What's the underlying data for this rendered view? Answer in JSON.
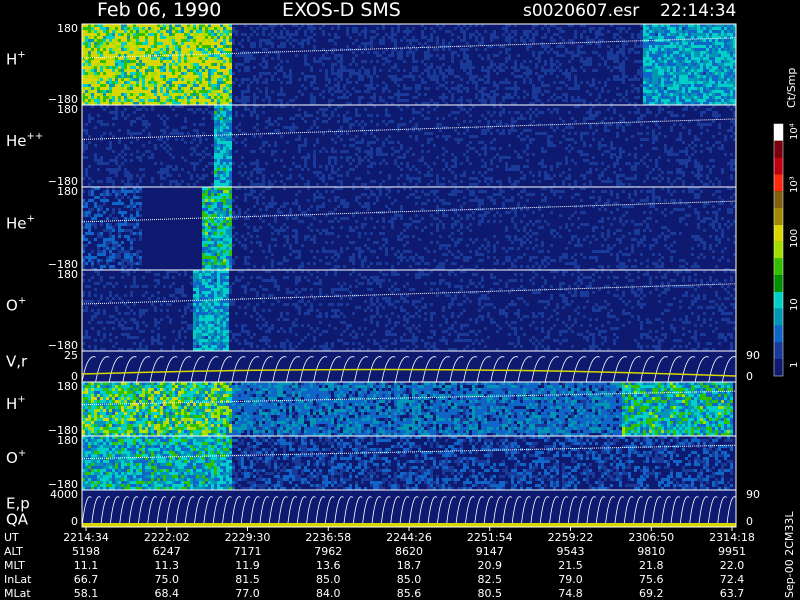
{
  "header": {
    "date": "Feb 06, 1990",
    "mission": "EXOS-D SMS",
    "file": "s0020607.esr",
    "time": "22:14:34"
  },
  "colorbar": {
    "title": "Ct/Smp",
    "ticks": [
      "10⁴",
      "10³",
      "100",
      "10",
      "1"
    ],
    "colors": [
      "#ffffff",
      "#7a0010",
      "#c00010",
      "#ff2a10",
      "#806010",
      "#a08a00",
      "#d8d800",
      "#a0e000",
      "#30c000",
      "#009000",
      "#00d0c8",
      "#0096b4",
      "#1066c8",
      "#1a3a9a",
      "#0d1a70"
    ]
  },
  "panels": [
    {
      "id": "h-plus",
      "label": "H",
      "sup": "+",
      "ytop": "180",
      "ybot": "−180"
    },
    {
      "id": "he-plus-plus",
      "label": "He",
      "sup": "++",
      "ytop": "180",
      "ybot": "−180"
    },
    {
      "id": "he-plus",
      "label": "He",
      "sup": "+",
      "ytop": "180",
      "ybot": "−180"
    },
    {
      "id": "o-plus",
      "label": "O",
      "sup": "+",
      "ytop": "180",
      "ybot": "−180"
    },
    {
      "id": "vr",
      "label": "V,r",
      "sup": "",
      "ytop": "25",
      "ybot": "0",
      "rtop": "90",
      "rbot": "0"
    },
    {
      "id": "h-plus-2",
      "label": "H",
      "sup": "+",
      "ytop": "180",
      "ybot": "−180"
    },
    {
      "id": "o-plus-2",
      "label": "O",
      "sup": "+",
      "ytop": "180",
      "ybot": "−180"
    },
    {
      "id": "ep-qa",
      "label": "E,p",
      "label2": "QA",
      "sup": "",
      "ytop": "4000",
      "ybot": "0",
      "rtop": "90",
      "rbot": "0"
    }
  ],
  "footer": {
    "version": "Sep-00 2CM33L",
    "rows": [
      {
        "label": "UT",
        "values": [
          "2214:34",
          "2222:02",
          "2229:30",
          "2236:58",
          "2244:26",
          "2251:54",
          "2259:22",
          "2306:50",
          "2314:18"
        ]
      },
      {
        "label": "ALT",
        "values": [
          "5198",
          "6247",
          "7171",
          "7962",
          "8620",
          "9147",
          "9543",
          "9810",
          "9951"
        ]
      },
      {
        "label": "MLT",
        "values": [
          "11.1",
          "11.3",
          "11.9",
          "13.6",
          "18.7",
          "20.9",
          "21.5",
          "21.8",
          "22.0"
        ]
      },
      {
        "label": "InLat",
        "values": [
          "66.7",
          "75.0",
          "81.5",
          "85.0",
          "85.0",
          "82.5",
          "79.0",
          "75.6",
          "72.4"
        ]
      },
      {
        "label": "MLat",
        "values": [
          "58.1",
          "68.4",
          "77.0",
          "84.0",
          "85.6",
          "80.5",
          "74.8",
          "69.2",
          "63.7"
        ]
      }
    ]
  },
  "chart_data": {
    "type": "heatmap",
    "title": "Feb 06, 1990   EXOS-D SMS",
    "colorbar_label": "Ct/Smp",
    "x_ticks": [
      "2214:34",
      "2222:02",
      "2229:30",
      "2236:58",
      "2244:26",
      "2251:54",
      "2259:22",
      "2306:50",
      "2314:18"
    ],
    "panels": [
      "H+",
      "He++",
      "He+",
      "O+",
      "V,r",
      "H+",
      "O+",
      "E,p QA"
    ],
    "ylim_pitch": [
      -180,
      180
    ],
    "ylim_vr": [
      0,
      25
    ],
    "ylim_ep": [
      0,
      4000
    ]
  }
}
